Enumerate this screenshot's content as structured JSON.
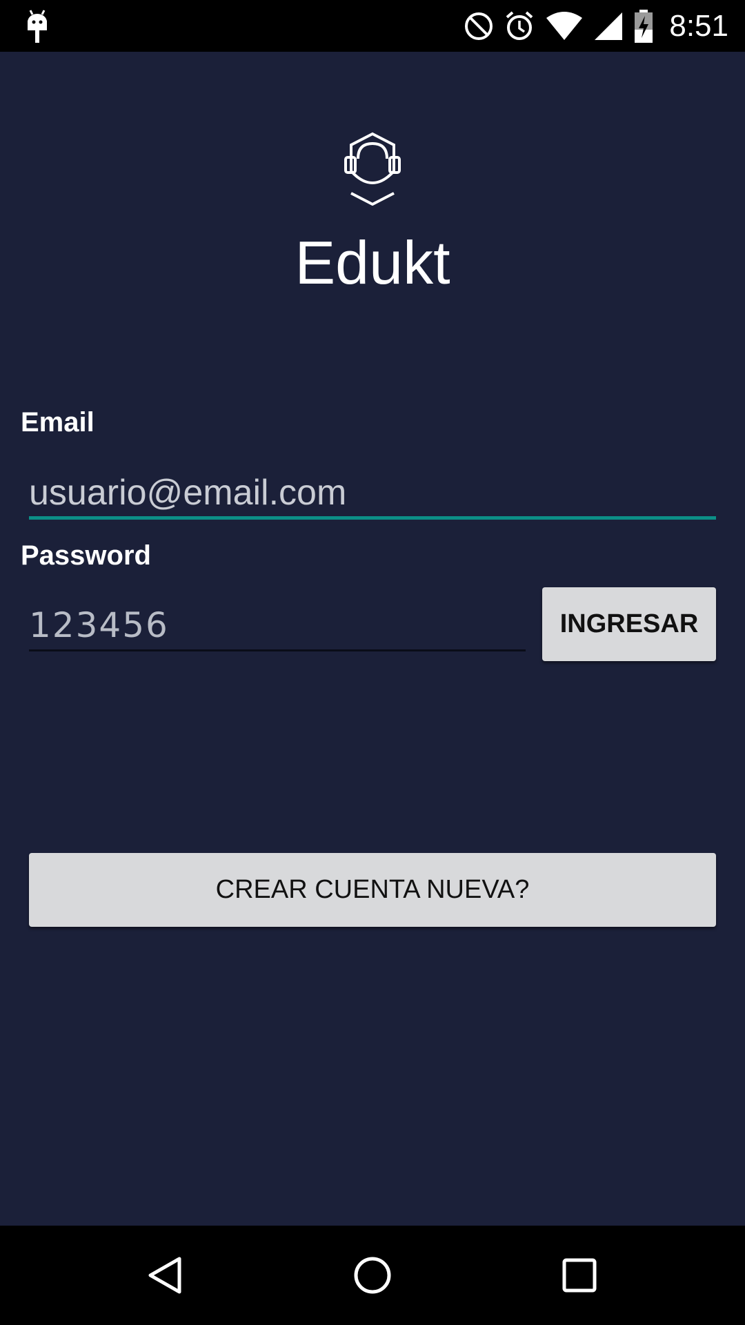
{
  "status_bar": {
    "time": "8:51",
    "icons": [
      "android-debug-icon",
      "do-not-disturb-icon",
      "alarm-icon",
      "wifi-icon",
      "signal-icon",
      "battery-charging-icon"
    ]
  },
  "app": {
    "logo_icon": "headset-shield-icon",
    "title": "Edukt"
  },
  "form": {
    "email_label": "Email",
    "email_value": "usuario@email.com",
    "password_label": "Password",
    "password_value": "123456",
    "login_button": "INGRESAR",
    "create_account_button": "CREAR CUENTA NUEVA?"
  },
  "nav_bar": {
    "icons": [
      "back-icon",
      "home-icon",
      "recents-icon"
    ]
  },
  "colors": {
    "background": "#1b2039",
    "accent": "#0c8f87",
    "button": "#d8d9db"
  }
}
